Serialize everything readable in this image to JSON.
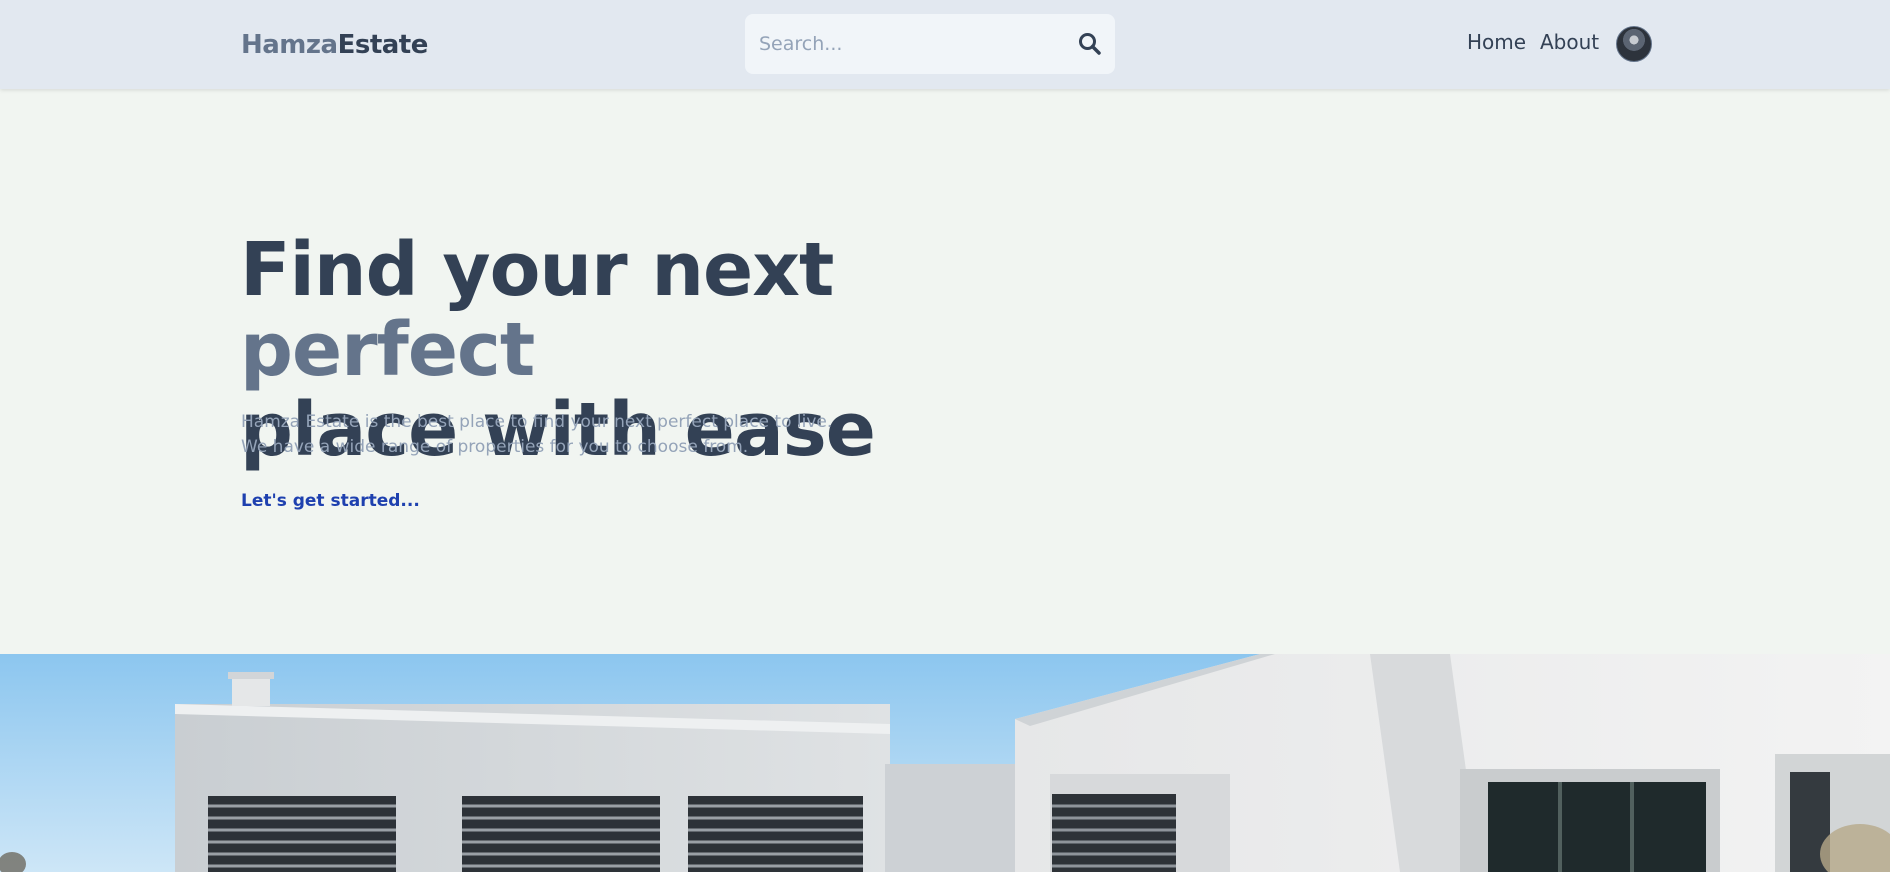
{
  "header": {
    "logo_part1": "Hamza",
    "logo_part2": "Estate",
    "search_placeholder": "Search...",
    "nav": {
      "home": "Home",
      "about": "About"
    }
  },
  "hero": {
    "title_part1": "Find your next ",
    "title_accent": "perfect",
    "title_part2": "place with ease",
    "desc_line1": "Hamza Estate is the best place to find your next perfect place to live.",
    "desc_line2": "We have a wide range of properties for you to choose from.",
    "cta": "Let's get started..."
  },
  "colors": {
    "header_bg": "#e2e8f0",
    "page_bg": "#f1f5f1",
    "text_dark": "#334155",
    "text_muted": "#64748b",
    "text_light": "#94a3b8",
    "link": "#1e40af"
  },
  "icons": {
    "search": "search-icon",
    "avatar": "profile-avatar"
  }
}
